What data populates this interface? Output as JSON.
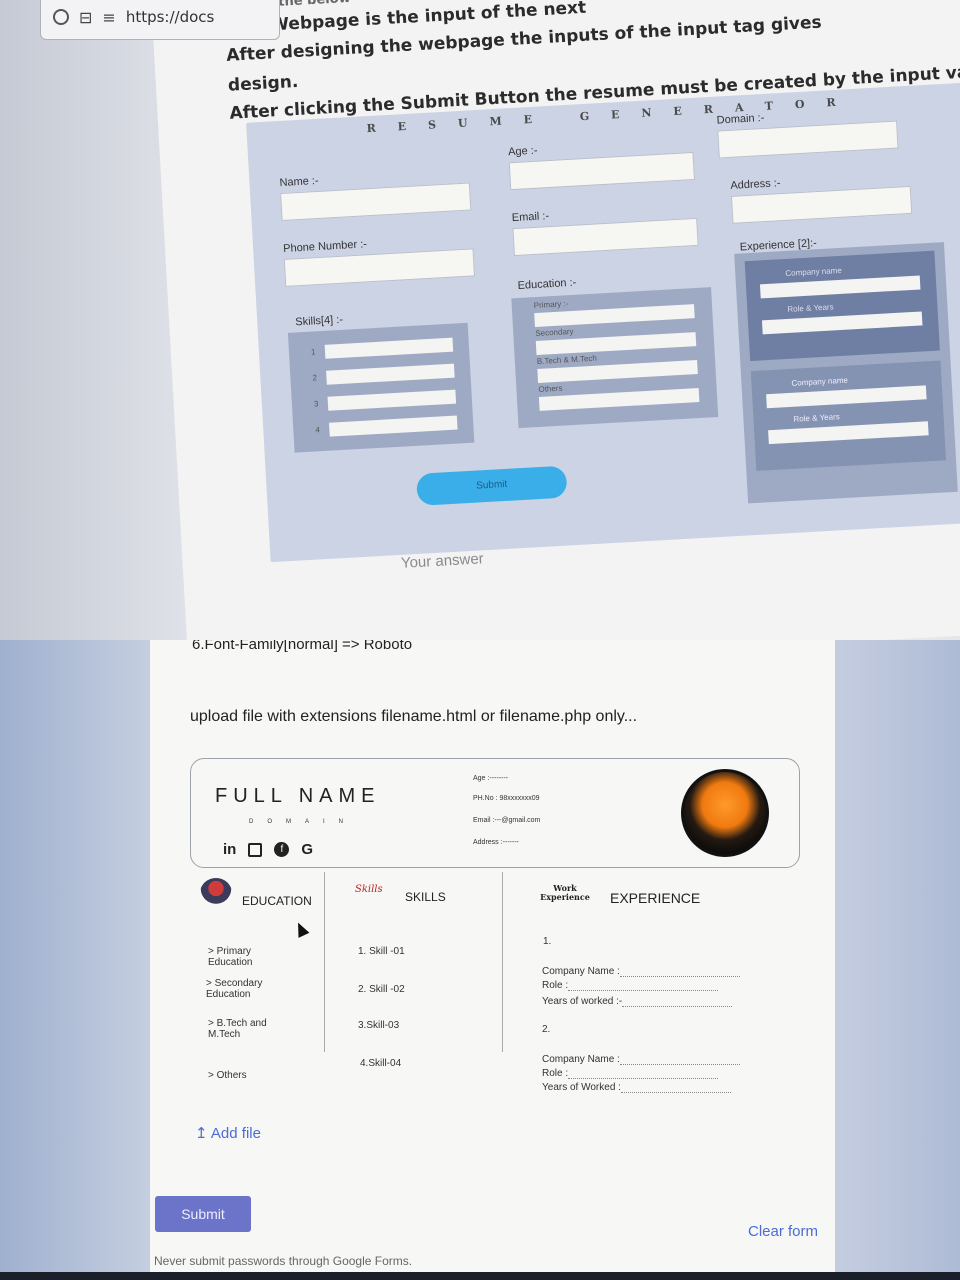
{
  "browser": {
    "url": "https://docs"
  },
  "instructions": {
    "line0": "Design the below",
    "line1": "This Webpage is the input of the next",
    "line2": "After designing the webpage the inputs of the input tag gives",
    "line3": "After clicking the Submit Button the resume must be created by the input values",
    "line4": "design."
  },
  "resume_form": {
    "title": "RESUME GENERATOR",
    "name_label": "Name :-",
    "age_label": "Age :-",
    "domain_label": "Domain :-",
    "phone_label": "Phone Number :-",
    "email_label": "Email :-",
    "address_label": "Address :-",
    "skills_label": "Skills[4] :-",
    "education_label": "Education :-",
    "experience_label": "Experience [2]:-",
    "skill_numbers": [
      "1",
      "2",
      "3",
      "4"
    ],
    "edu_items": [
      "Primary :-",
      "Secondary",
      "B.Tech & M.Tech",
      "Others"
    ],
    "exp_items": [
      "Company name",
      "Role & Years",
      "Company name",
      "Role & Years"
    ],
    "submit_label": "Submit"
  },
  "answer_placeholder": "Your answer",
  "question_font": "6.Font-Family[normal] => Roboto",
  "question_upload": "upload file with extensions  filename.html  or  filename.php  only...",
  "resume_preview": {
    "full_name": "FULL NAME",
    "domain": "DOMAIN",
    "social_in": "in",
    "social_g": "G",
    "age": "Age :--------",
    "phone": "PH.No : 98xxxxxxx09",
    "email": "Email :---@gmail.com",
    "address": "Address :-------",
    "education": {
      "heading": "EDUCATION",
      "items": [
        "> Primary Education",
        "> Secondary Education",
        "> B.Tech and M.Tech",
        "> Others"
      ]
    },
    "skills": {
      "heading": "SKILLS",
      "icon_text": "Skills",
      "items": [
        "1. Skill -01",
        "2. Skill -02",
        "3.Skill-03",
        "4.Skill-04"
      ]
    },
    "experience": {
      "heading": "EXPERIENCE",
      "icon_text": "Work Experience",
      "n1": "1.",
      "n2": "2.",
      "company1": "Company Name :",
      "role1": "Role :",
      "years1": "Years of worked :-",
      "company2": "Company Name :",
      "role2": "Role :",
      "years2": "Years of Worked :"
    }
  },
  "add_file_label": "Add file",
  "submit_label": "Submit",
  "clear_label": "Clear form",
  "footer_note": "Never submit passwords through Google Forms."
}
